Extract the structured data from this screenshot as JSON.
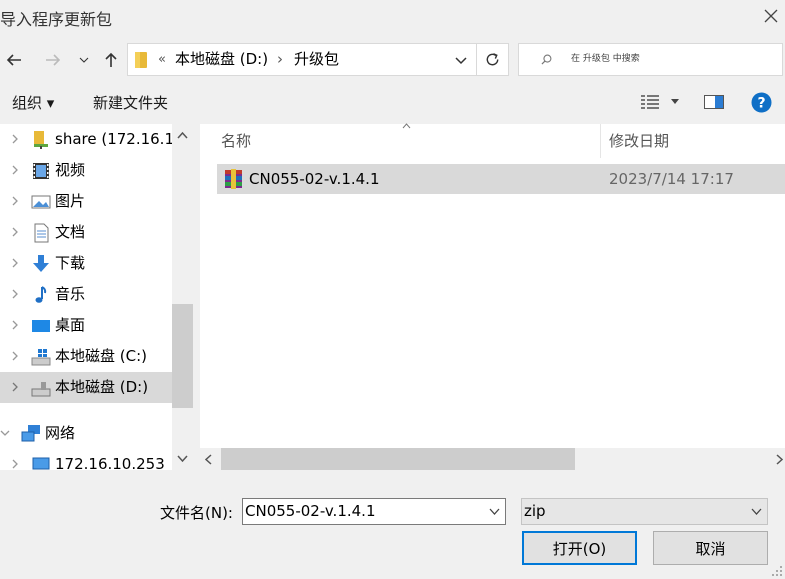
{
  "window": {
    "title": "导入程序更新包"
  },
  "nav": {
    "breadcrumb": [
      "本地磁盘 (D:)",
      "升级包"
    ],
    "overflow_symbol": "«",
    "separator": "›",
    "search_placeholder": "在 升级包 中搜索"
  },
  "toolbar": {
    "organize_label": "组织 ▾",
    "new_folder_label": "新建文件夹"
  },
  "sidebar": {
    "items": [
      {
        "label": "share (172.16.10",
        "icon": "network-share-icon"
      },
      {
        "label": "视频",
        "icon": "videos-icon"
      },
      {
        "label": "图片",
        "icon": "pictures-icon"
      },
      {
        "label": "文档",
        "icon": "documents-icon"
      },
      {
        "label": "下载",
        "icon": "downloads-icon"
      },
      {
        "label": "音乐",
        "icon": "music-icon"
      },
      {
        "label": "桌面",
        "icon": "desktop-icon"
      },
      {
        "label": "本地磁盘 (C:)",
        "icon": "windows-drive-icon"
      },
      {
        "label": "本地磁盘 (D:)",
        "icon": "drive-icon",
        "selected": true
      },
      {
        "label": "网络",
        "icon": "network-icon"
      },
      {
        "label": "172.16.10.253",
        "icon": "computer-icon"
      }
    ]
  },
  "file_list": {
    "columns": {
      "name": "名称",
      "date": "修改日期"
    },
    "rows": [
      {
        "name": "CN055-02-v.1.4.1",
        "date": "2023/7/14 17:17",
        "icon": "winrar-archive-icon"
      }
    ]
  },
  "footer": {
    "filename_label": "文件名(N):",
    "filename_value": "CN055-02-v.1.4.1",
    "filetype_value": "zip",
    "open_label": "打开(O)",
    "cancel_label": "取消"
  },
  "colors": {
    "accent": "#0078d7",
    "selection": "#d9d9d9"
  }
}
